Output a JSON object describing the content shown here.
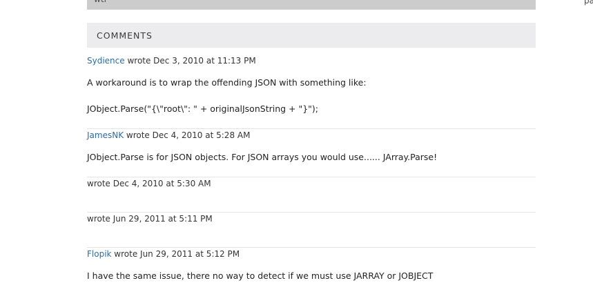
{
  "top_bar": {
    "text": "wtf"
  },
  "right_clip": {
    "text": "pa"
  },
  "comments": {
    "heading": "COMMENTS",
    "items": [
      {
        "author": "Sydience",
        "meta": " wrote Dec 3, 2010 at 11:13 PM",
        "lines": [
          "A workaround is to wrap the offending JSON with something like:",
          "JObject.Parse(\"{\\\"root\\\": \" + originalJsonString + \"}\");"
        ]
      },
      {
        "author": "JamesNK",
        "meta": " wrote Dec 4, 2010 at 5:28 AM",
        "lines": [
          "JObject.Parse is for JSON objects. For JSON arrays you would use...... JArray.Parse!"
        ]
      },
      {
        "author": "",
        "meta": "wrote Dec 4, 2010 at 5:30 AM",
        "lines": []
      },
      {
        "author": "",
        "meta": "wrote Jun 29, 2011 at 5:11 PM",
        "lines": []
      },
      {
        "author": "Flopik",
        "meta": " wrote Jun 29, 2011 at 5:12 PM",
        "lines": [
          "I have the same issue, there no way to detect if we must use JARRAY or JOBJECT"
        ]
      }
    ]
  }
}
